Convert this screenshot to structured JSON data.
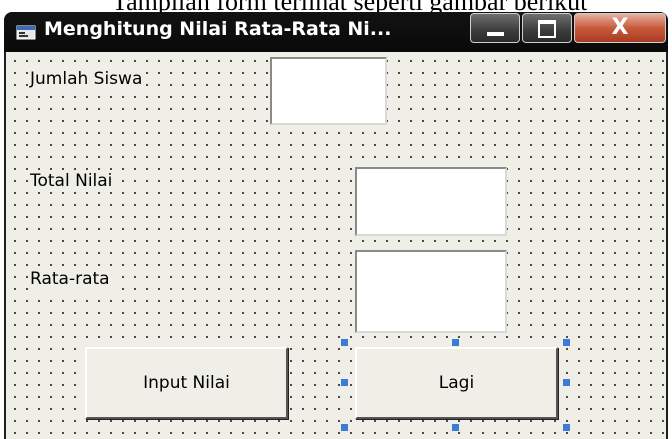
{
  "caption": {
    "text": "Tampilan form terlihat seperti gambar berikut"
  },
  "window": {
    "title": "Menghitung Nilai Rata-Rata Ni...",
    "controls": {
      "minimize": "minimize",
      "maximize": "maximize",
      "close": "X"
    }
  },
  "form": {
    "labels": {
      "jumlah_siswa": "Jumlah Siswa",
      "total_nilai": "Total Nilai",
      "rata_rata": "Rata-rata"
    },
    "fields": {
      "jumlah_siswa": "",
      "total_nilai": "",
      "rata_rata": ""
    },
    "buttons": {
      "input_nilai": "Input Nilai",
      "lagi": "Lagi"
    },
    "selected_control": "Lagi"
  },
  "colors": {
    "titlebar": "#121212",
    "form_background": "#efefe8",
    "selection_handle": "#3d7bd8",
    "close_button": "#c85a3c"
  }
}
